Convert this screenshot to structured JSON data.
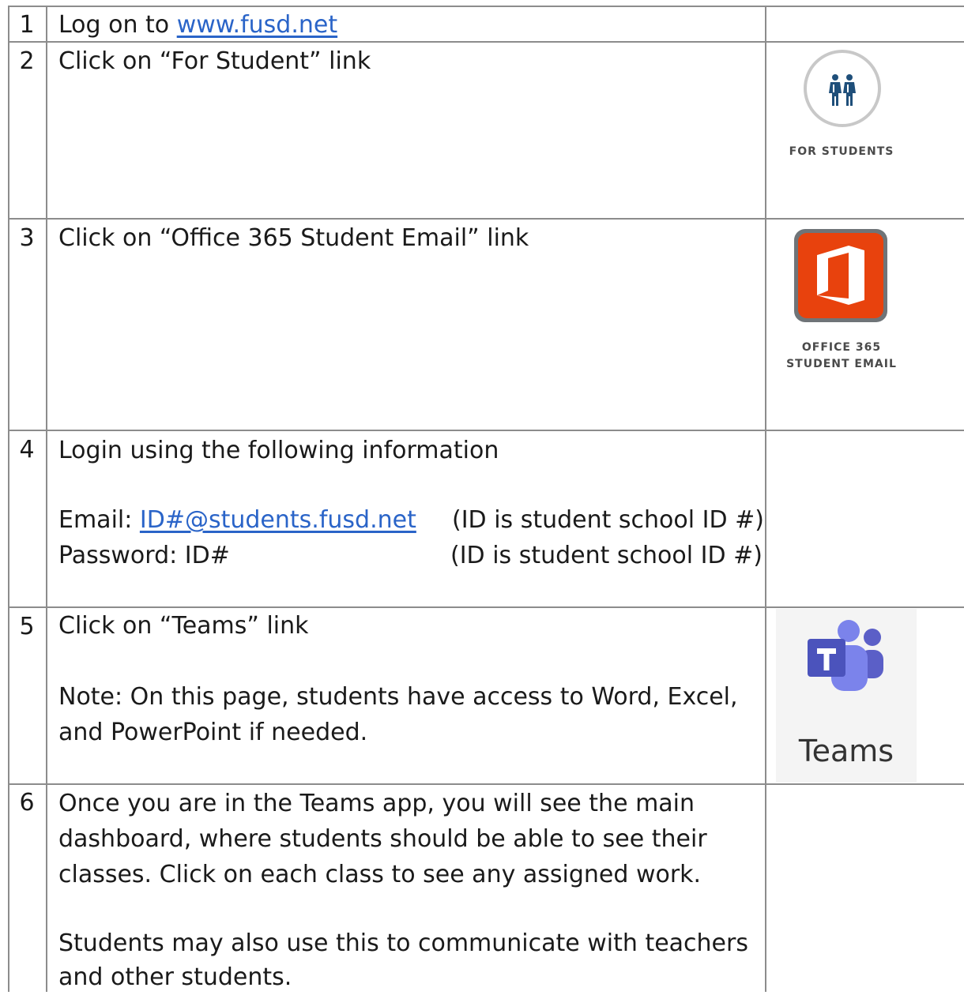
{
  "rows": [
    {
      "num": "1",
      "prefix": "Log on to ",
      "link": "www.fusd.net"
    },
    {
      "num": "2",
      "text": "Click on “For Student” link",
      "icon_caption": "FOR STUDENTS"
    },
    {
      "num": "3",
      "text": "Click on “Office 365 Student Email” link",
      "icon_caption": [
        "OFFICE 365",
        "STUDENT EMAIL"
      ]
    },
    {
      "num": "4",
      "text": "Login using the following information",
      "email_label": "Email: ",
      "email_link": "ID#@students.fusd.net",
      "email_note": "(ID is student school ID #)",
      "password_label": "Password: ID#",
      "password_note": "(ID is student school ID #)"
    },
    {
      "num": "5",
      "text": "Click on “Teams” link",
      "note_lines": [
        "Note: On this page, students have access to Word, Excel,",
        "and PowerPoint if needed."
      ],
      "icon_caption": "Teams"
    },
    {
      "num": "6",
      "lines": [
        "Once you are in the Teams app, you will see the main",
        "dashboard, where students should be able to see their",
        "classes. Click on each class to see any assigned work."
      ],
      "lines2": [
        "Students may also use this to communicate with teachers",
        "and other students."
      ]
    }
  ],
  "colors": {
    "link": "#2a64c8",
    "office_orange": "#e8420d",
    "teams_purple": "#5b5fc7",
    "border": "#8c8c8c"
  }
}
